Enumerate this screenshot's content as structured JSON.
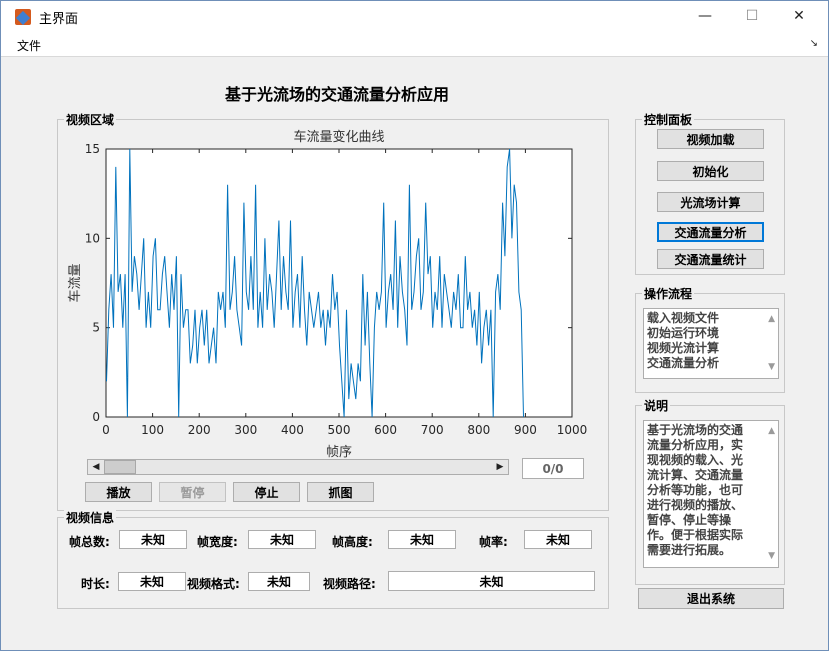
{
  "window": {
    "title": "主界面",
    "minimize": "—",
    "maximize": "☐",
    "close": "✕"
  },
  "menu": {
    "file": "文件",
    "overflow": "↘"
  },
  "app_title": "基于光流场的交通流量分析应用",
  "video_area": {
    "label": "视频区域"
  },
  "chart_data": {
    "type": "line",
    "title": "车流量变化曲线",
    "xlabel": "帧序",
    "ylabel": "车流量",
    "xlim": [
      0,
      1000
    ],
    "ylim": [
      0,
      15
    ],
    "xticks": [
      0,
      100,
      200,
      300,
      400,
      500,
      600,
      700,
      800,
      900,
      1000
    ],
    "yticks": [
      0,
      5,
      10,
      15
    ],
    "grid": false,
    "color": "#0072bd",
    "series": [
      {
        "x_start": 1,
        "x_step": 5,
        "values": [
          2,
          6,
          8,
          5,
          14,
          7,
          8,
          5,
          8,
          0,
          15,
          7,
          9,
          8,
          6,
          8,
          10,
          5,
          7,
          5,
          9,
          10,
          6,
          6,
          8,
          9,
          7,
          5,
          8,
          6,
          9,
          0,
          8,
          5,
          6,
          6,
          3,
          4,
          6,
          3,
          5,
          6,
          4,
          6,
          3,
          4,
          5,
          3,
          7,
          6,
          7,
          5,
          13,
          6,
          7,
          9,
          6,
          5,
          4,
          12,
          7,
          6,
          9,
          6,
          13,
          5,
          7,
          5,
          10,
          6,
          8,
          7,
          5,
          8,
          11,
          6,
          9,
          7,
          6,
          11,
          5,
          7,
          8,
          5,
          9,
          6,
          4,
          7,
          6,
          5,
          6,
          7,
          5,
          6,
          4,
          6,
          5,
          8,
          6,
          7,
          4,
          2,
          0,
          6,
          1,
          3,
          2,
          1,
          3,
          2,
          8,
          4,
          7,
          3,
          0,
          5,
          7,
          6,
          7,
          12,
          5,
          7,
          8,
          6,
          11,
          5,
          9,
          7,
          6,
          4,
          13,
          6,
          7,
          9,
          10,
          6,
          7,
          12,
          8,
          9,
          5,
          7,
          6,
          9,
          5,
          8,
          7,
          6,
          5,
          7,
          6,
          8,
          5,
          5,
          9,
          6,
          7,
          5,
          6,
          4,
          7,
          3,
          5,
          6,
          4,
          6,
          0,
          7,
          8,
          6,
          12,
          9,
          14,
          15,
          10,
          13,
          12,
          7,
          6,
          0
        ]
      }
    ]
  },
  "playback": {
    "frame_counter": "0/0",
    "play": "播放",
    "pause": "暂停",
    "stop": "停止",
    "capture": "抓图"
  },
  "video_info": {
    "label": "视频信息",
    "total_frames_label": "帧总数:",
    "total_frames_value": "未知",
    "frame_width_label": "帧宽度:",
    "frame_width_value": "未知",
    "frame_height_label": "帧高度:",
    "frame_height_value": "未知",
    "frame_rate_label": "帧率:",
    "frame_rate_value": "未知",
    "duration_label": "时长:",
    "duration_value": "未知",
    "format_label": "视频格式:",
    "format_value": "未知",
    "path_label": "视频路径:",
    "path_value": "未知"
  },
  "control_panel": {
    "label": "控制面板",
    "load_video": "视频加载",
    "initialize": "初始化",
    "optical_flow": "光流场计算",
    "traffic_analysis": "交通流量分析",
    "traffic_stats": "交通流量统计"
  },
  "workflow": {
    "label": "操作流程",
    "items": [
      "载入视频文件",
      "初始运行环境",
      "视频光流计算",
      "交通流量分析"
    ]
  },
  "description": {
    "label": "说明",
    "lines": [
      "基于光流场的交通",
      "流量分析应用，实",
      "现视频的载入、光",
      "流计算、交通流量",
      "分析等功能，也可",
      "进行视频的播放、",
      "暂停、停止等操",
      "作。便于根据实际",
      "需要进行拓展。"
    ]
  },
  "exit_button": "退出系统"
}
